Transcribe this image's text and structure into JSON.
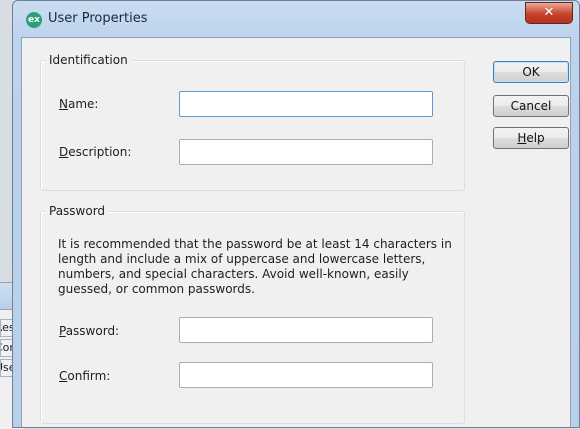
{
  "background_window": {
    "cells": [
      "Resource",
      "Configure",
      "Users"
    ]
  },
  "window": {
    "title": "User Properties",
    "icon_text": "ex",
    "close_glyph": "✕"
  },
  "identification": {
    "legend": "Identification",
    "name_label_underlined": "N",
    "name_label_rest": "ame:",
    "name_value": "",
    "description_label_underlined": "D",
    "description_label_rest": "escription:",
    "description_value": ""
  },
  "password_group": {
    "legend": "Password",
    "recommendation": "It is recommended that the password be at least 14 characters in length and include a mix of uppercase and lowercase letters, numbers, and special characters. Avoid well-known, easily guessed, or common passwords.",
    "password_label_underlined": "P",
    "password_label_rest": "assword:",
    "password_value": "",
    "confirm_label_underlined": "C",
    "confirm_label_rest": "onfirm:",
    "confirm_value": ""
  },
  "buttons": {
    "ok": "OK",
    "cancel": "Cancel",
    "help_underlined": "H",
    "help_rest": "elp"
  },
  "colors": {
    "accent": "#3c7fb1",
    "close": "#c7412a",
    "icon": "#2aa07a"
  }
}
